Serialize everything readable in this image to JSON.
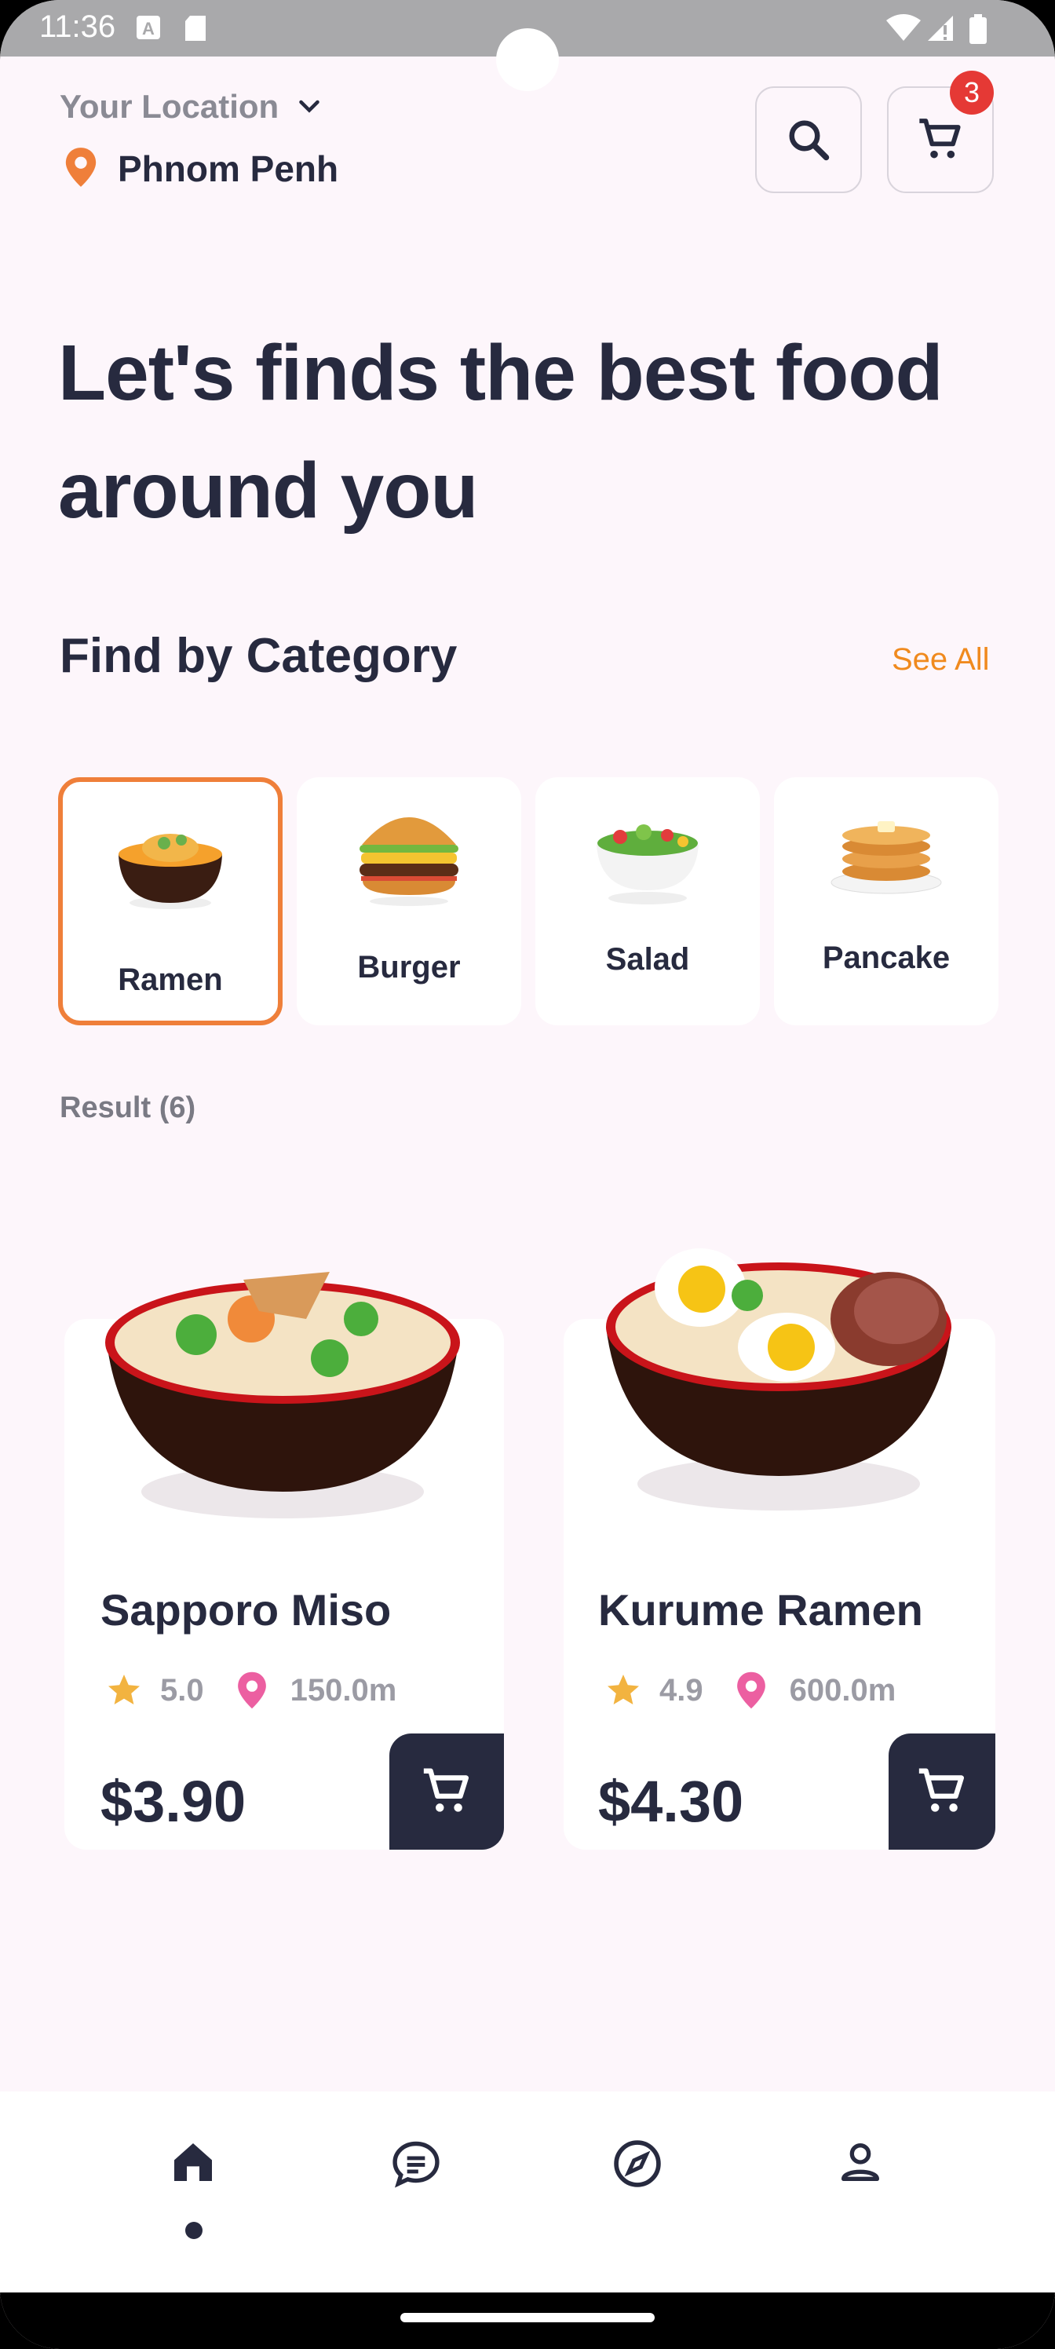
{
  "status_bar": {
    "time": "11:36"
  },
  "header": {
    "location_label": "Your Location",
    "location_city": "Phnom Penh",
    "cart_badge": "3"
  },
  "headline": "Let's finds the best food around you",
  "category_section": {
    "title": "Find by Category",
    "see_all": "See All",
    "items": [
      {
        "label": "Ramen",
        "selected": true
      },
      {
        "label": "Burger",
        "selected": false
      },
      {
        "label": "Salad",
        "selected": false
      },
      {
        "label": "Pancake",
        "selected": false
      }
    ]
  },
  "result_label": "Result (6)",
  "foods": [
    {
      "name": "Sapporo Miso",
      "rating": "5.0",
      "distance": "150.0m",
      "price": "$3.90"
    },
    {
      "name": "Kurume Ramen",
      "rating": "4.9",
      "distance": "600.0m",
      "price": "$4.30"
    }
  ],
  "bottom_nav": [
    {
      "icon": "home-icon",
      "active": true
    },
    {
      "icon": "chat-icon",
      "active": false
    },
    {
      "icon": "compass-icon",
      "active": false
    },
    {
      "icon": "profile-icon",
      "active": false
    }
  ],
  "colors": {
    "accent": "#ef7f3a",
    "dark": "#272a3f",
    "background": "#fdf6fb",
    "badge": "#e53935",
    "star": "#f2b340",
    "pin": "#ec5fa1"
  }
}
